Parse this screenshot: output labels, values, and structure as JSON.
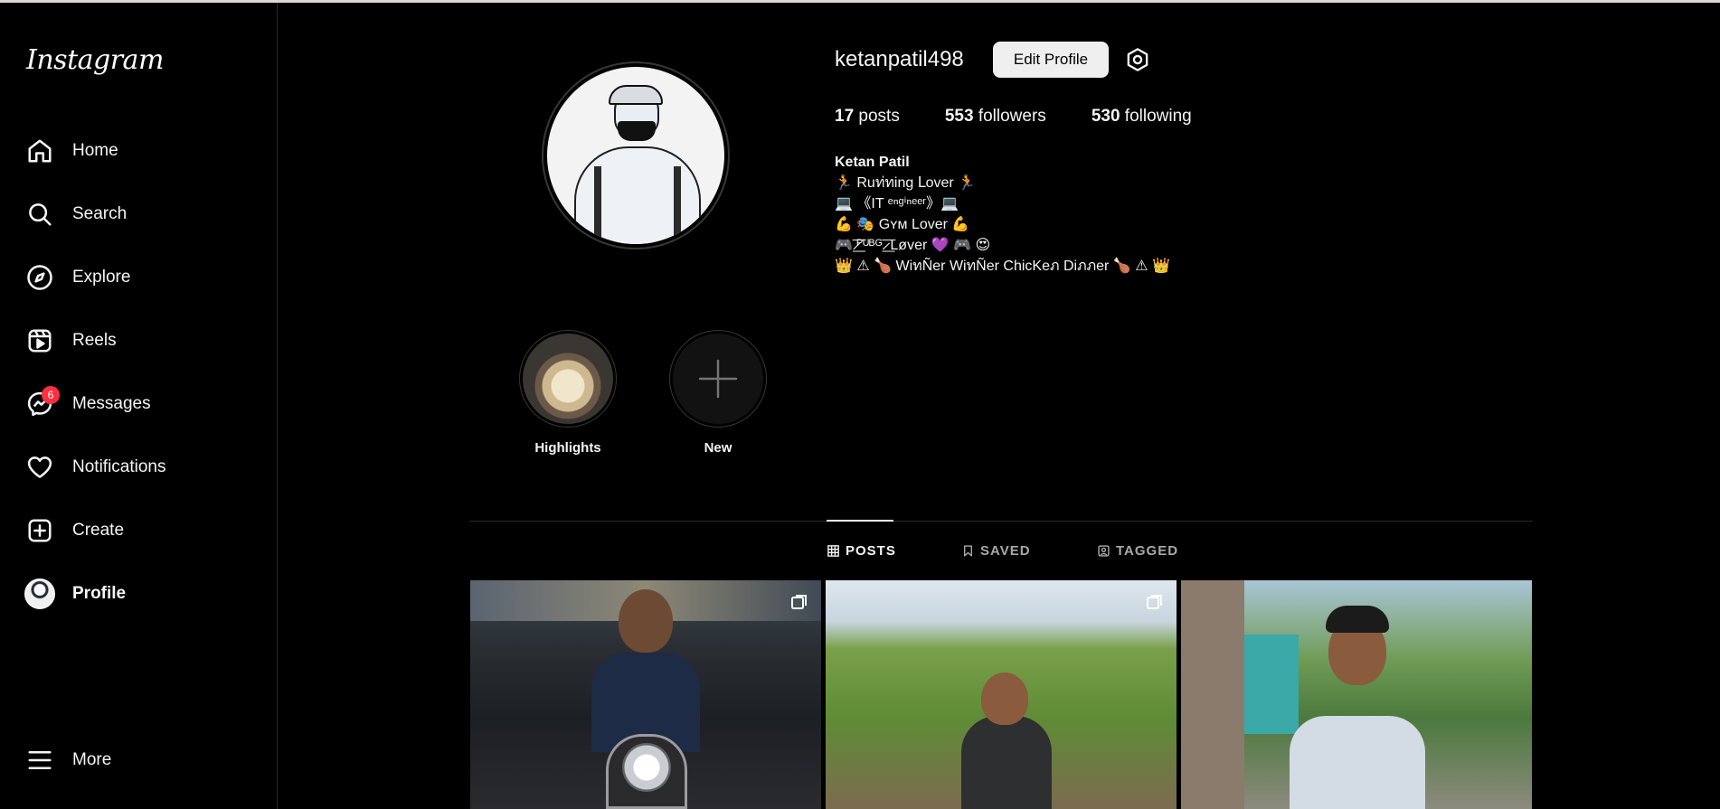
{
  "sidebar": {
    "logo": "Instagram",
    "items": [
      {
        "label": "Home",
        "icon": "home-icon"
      },
      {
        "label": "Search",
        "icon": "search-icon"
      },
      {
        "label": "Explore",
        "icon": "compass-icon"
      },
      {
        "label": "Reels",
        "icon": "reels-icon"
      },
      {
        "label": "Messages",
        "icon": "messenger-icon",
        "badge": "6"
      },
      {
        "label": "Notifications",
        "icon": "heart-icon"
      },
      {
        "label": "Create",
        "icon": "plus-square-icon"
      },
      {
        "label": "Profile",
        "icon": "avatar"
      }
    ],
    "more": "More"
  },
  "profile": {
    "username": "ketanpatil498",
    "edit_button": "Edit Profile",
    "stats": {
      "posts_count": "17",
      "posts_label": "posts",
      "followers_count": "553",
      "followers_label": "followers",
      "following_count": "530",
      "following_label": "following"
    },
    "bio": {
      "name": "Ketan Patil",
      "lines": [
        "🏃 Ruท่ทing ᒪover 🏃",
        "💻 《IT ᵉⁿᵍⁱⁿᵉᵉʳ》💻",
        "💪 🎭 Gʏм Lover 💪",
        "🎮 ̷͟͞ᴾᵁᴮᴳ ̷͟͞ Løver 💜 🎮 😍",
        "👑 ⚠ 🍗 WiทÑer WiทÑer ChicKeภ Diภภer 🍗 ⚠ 👑"
      ]
    }
  },
  "highlights": [
    {
      "label": "Highlights"
    },
    {
      "label": "New"
    }
  ],
  "tabs": [
    {
      "label": "POSTS",
      "icon": "grid-icon"
    },
    {
      "label": "SAVED",
      "icon": "bookmark-icon"
    },
    {
      "label": "TAGGED",
      "icon": "tagged-icon"
    }
  ],
  "colors": {
    "background": "#000000",
    "badge": "#ff3040",
    "button_bg": "#efefef",
    "divider": "#262626"
  }
}
